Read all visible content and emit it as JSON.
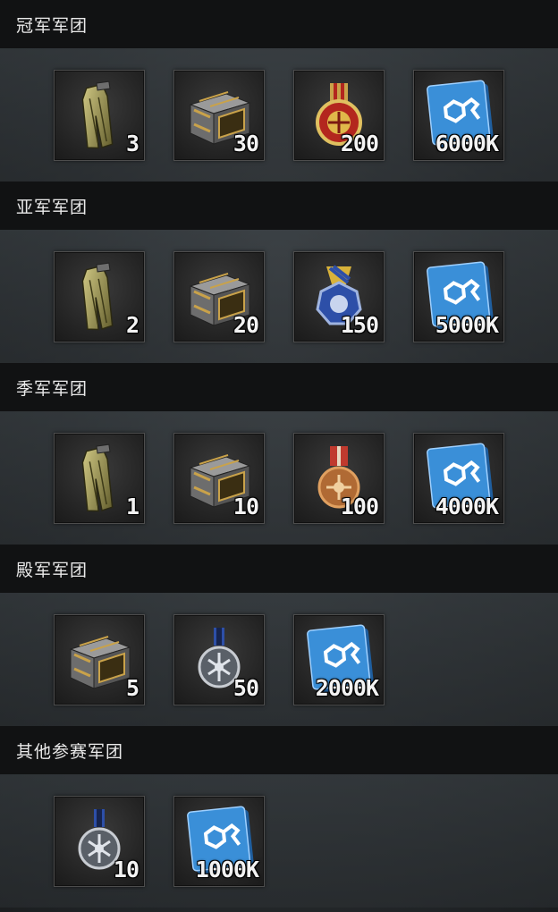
{
  "sections": [
    {
      "title": "冠军军团",
      "items": [
        {
          "icon": "uniform-icon",
          "count": "3"
        },
        {
          "icon": "crate-icon",
          "count": "30"
        },
        {
          "icon": "gold-medal-icon",
          "count": "200"
        },
        {
          "icon": "credits-card-icon",
          "count": "6000K"
        }
      ]
    },
    {
      "title": "亚军军团",
      "items": [
        {
          "icon": "uniform-icon",
          "count": "2"
        },
        {
          "icon": "crate-icon",
          "count": "20"
        },
        {
          "icon": "silver-medal-icon",
          "count": "150"
        },
        {
          "icon": "credits-card-icon",
          "count": "5000K"
        }
      ]
    },
    {
      "title": "季军军团",
      "items": [
        {
          "icon": "uniform-icon",
          "count": "1"
        },
        {
          "icon": "crate-icon",
          "count": "10"
        },
        {
          "icon": "bronze-medal-icon",
          "count": "100"
        },
        {
          "icon": "credits-card-icon",
          "count": "4000K"
        }
      ]
    },
    {
      "title": "殿军军团",
      "items": [
        {
          "icon": "crate-icon",
          "count": "5"
        },
        {
          "icon": "steel-medal-icon",
          "count": "50"
        },
        {
          "icon": "credits-card-icon",
          "count": "2000K"
        }
      ]
    },
    {
      "title": "其他参赛军团",
      "items": [
        {
          "icon": "steel-medal-icon",
          "count": "10"
        },
        {
          "icon": "credits-card-icon",
          "count": "1000K"
        }
      ]
    }
  ],
  "colors": {
    "header_bg": "#111213",
    "card_blue": "#2f7fc9",
    "gold": "#c9a24a",
    "medal_red": "#b3261e",
    "medal_blue": "#2d4fa8"
  }
}
